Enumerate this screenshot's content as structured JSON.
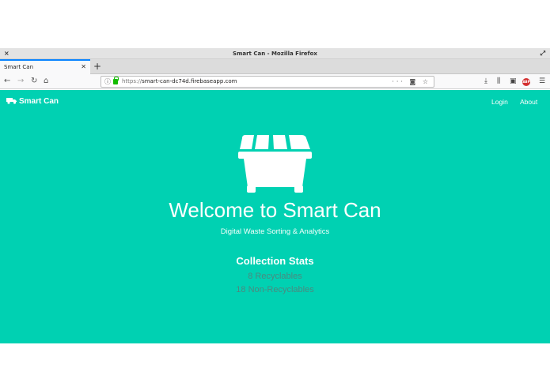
{
  "window": {
    "title": "Smart Can - Mozilla Firefox"
  },
  "tabs": [
    {
      "label": "Smart Can"
    }
  ],
  "urlbar": {
    "prefix": "https://",
    "domain": "smart-can-dc74d.firebaseapp.com"
  },
  "site": {
    "brand": "Smart Can",
    "nav": {
      "login": "Login",
      "about": "About"
    },
    "hero": {
      "title": "Welcome to Smart Can",
      "subtitle": "Digital Waste Sorting & Analytics"
    },
    "stats": {
      "title": "Collection Stats",
      "recyclables": "8 Recyclables",
      "non_recyclables": "18 Non-Recyclables"
    }
  },
  "colors": {
    "page_background": "#00d1b2",
    "stat_text": "#4a8a80",
    "tab_accent": "#0a84ff"
  }
}
